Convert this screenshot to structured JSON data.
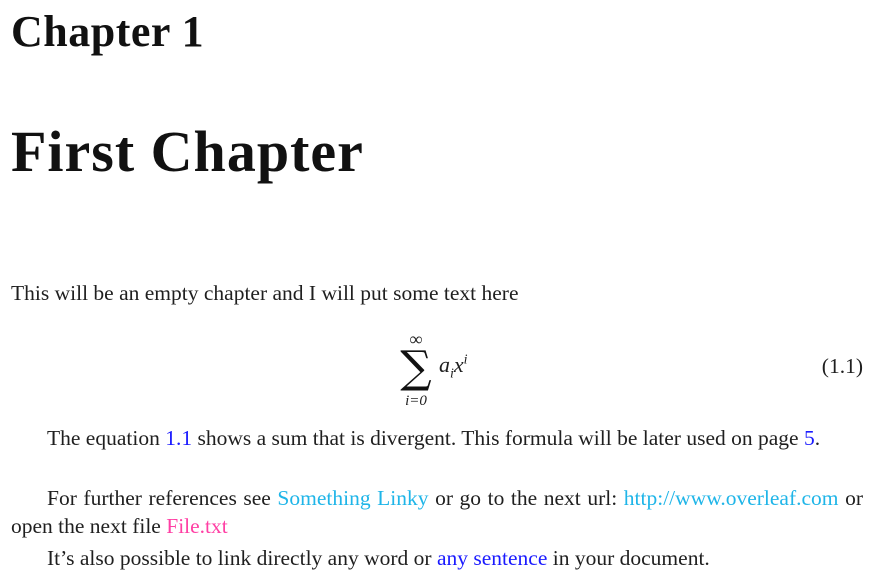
{
  "chapter": {
    "number_label": "Chapter 1",
    "title": "First Chapter"
  },
  "intro": {
    "text": "This will be an empty chapter and I will put some text here"
  },
  "equation": {
    "sum_symbol": "∑",
    "upper_limit": "∞",
    "lower_limit": "i=0",
    "term_base_a": "a",
    "term_sub_i": "i",
    "term_base_x": "x",
    "term_sup_i": "i",
    "number": "(1.1)"
  },
  "paragraphs": {
    "p1": {
      "before": "The equation ",
      "eq_ref": "1.1",
      "middle": " shows a sum that is divergent. This formula will be later used on page ",
      "page_ref": "5",
      "after": "."
    },
    "p2": {
      "before": "For further references see ",
      "link_text": "Something Linky",
      "middle": " or go to the next url: ",
      "url": "http://www.overleaf.com",
      "middle2": " or open the next file ",
      "file": "File.txt"
    },
    "p3": {
      "before": "It’s also possible to link directly any word or ",
      "anchor_text": "any sentence",
      "after": " in your document."
    }
  },
  "colors": {
    "internal_link": "#1a1aff",
    "url_link": "#1fb5e8",
    "file_link": "#ff3fa4"
  }
}
